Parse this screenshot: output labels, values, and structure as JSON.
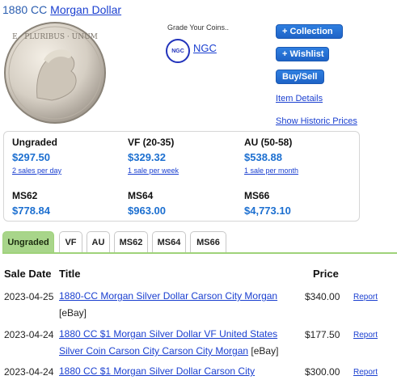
{
  "header": {
    "year": "1880 CC",
    "coin_name": "Morgan Dollar"
  },
  "coin_image": {
    "alt": "Morgan Dollar coin"
  },
  "grading": {
    "label": "Grade Your Coins..",
    "badge_text": "NGC",
    "link_text": "NGC"
  },
  "actions": {
    "collection": "+ Collection",
    "wishlist": "+ Wishlist",
    "buy_sell": "Buy/Sell",
    "item_details": "Item Details",
    "historic_prices": "Show Historic Prices"
  },
  "prices": [
    {
      "grade": "Ungraded",
      "price": "$297.50",
      "rate": "2 sales per day"
    },
    {
      "grade": "VF (20-35)",
      "price": "$329.32",
      "rate": "1 sale per week"
    },
    {
      "grade": "AU (50-58)",
      "price": "$538.88",
      "rate": "1 sale per month"
    },
    {
      "grade": "MS62",
      "price": "$778.84"
    },
    {
      "grade": "MS64",
      "price": "$963.00"
    },
    {
      "grade": "MS66",
      "price": "$4,773.10"
    }
  ],
  "tabs": [
    {
      "label": "Ungraded",
      "active": true
    },
    {
      "label": "VF"
    },
    {
      "label": "AU"
    },
    {
      "label": "MS62"
    },
    {
      "label": "MS64"
    },
    {
      "label": "MS66"
    }
  ],
  "sales": {
    "headers": {
      "date": "Sale Date",
      "title": "Title",
      "price": "Price"
    },
    "rows": [
      {
        "date": "2023-04-25",
        "title": "1880-CC Morgan Silver Dollar Carson City Morgan",
        "source": "[eBay]",
        "price": "$340.00",
        "report": "Report"
      },
      {
        "date": "2023-04-24",
        "title": "1880 CC $1 Morgan Silver Dollar VF United States Silver Coin Carson City Carson City Morgan",
        "source": "[eBay]",
        "price": "$177.50",
        "report": "Report"
      },
      {
        "date": "2023-04-24",
        "title": "1880 CC $1 Morgan Silver Dollar Carson City",
        "source": "",
        "price": "$300.00",
        "report": "Report"
      }
    ]
  },
  "colors": {
    "accent": "#1c6fd0",
    "button": "#1e63c7",
    "active_tab": "#a8d58a",
    "link": "#1a3fd0"
  }
}
